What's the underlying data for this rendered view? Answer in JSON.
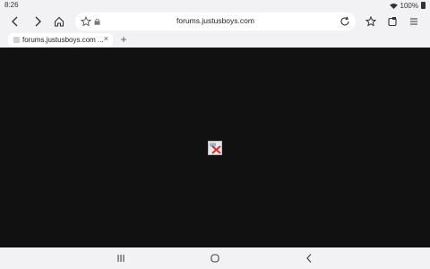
{
  "status": {
    "time": "8:26",
    "battery": "100%"
  },
  "toolbar": {
    "url": "forums.justusboys.com"
  },
  "tabs": [
    {
      "title": "forums.justusboys.com ...",
      "close": "×"
    }
  ],
  "newtab": "+",
  "content": {
    "background": "#111111"
  }
}
